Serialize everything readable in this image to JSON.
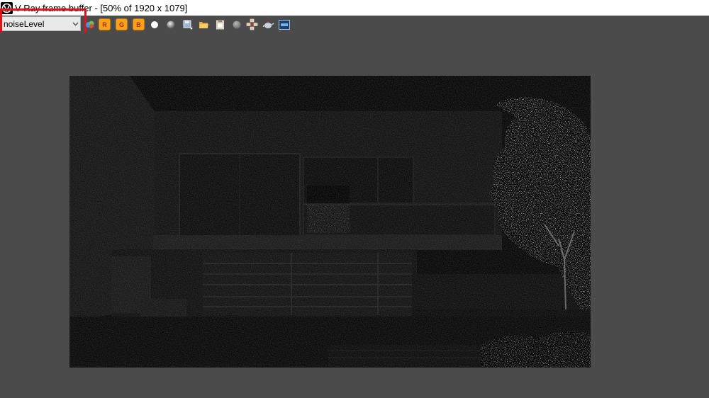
{
  "window": {
    "title": "V-Ray frame buffer - [50% of 1920 x 1079]"
  },
  "toolbar": {
    "channel_select": {
      "value": "noiseLevel"
    },
    "buttons": [
      {
        "name": "color-palette-icon"
      },
      {
        "name": "channel-r-button",
        "label": "R"
      },
      {
        "name": "channel-g-button",
        "label": "G"
      },
      {
        "name": "channel-b-button",
        "label": "B"
      },
      {
        "name": "white-circle-icon"
      },
      {
        "name": "grey-sphere-icon"
      },
      {
        "name": "save-image-icon"
      },
      {
        "name": "open-folder-icon"
      },
      {
        "name": "clipboard-icon"
      },
      {
        "name": "grey-circle-icon"
      },
      {
        "name": "region-render-icon"
      },
      {
        "name": "teapot-render-icon"
      },
      {
        "name": "vfb-settings-icon"
      }
    ]
  },
  "colors": {
    "background": "#4b4b4b",
    "highlight": "#e3121a",
    "channel_button": "#f5a21c"
  }
}
